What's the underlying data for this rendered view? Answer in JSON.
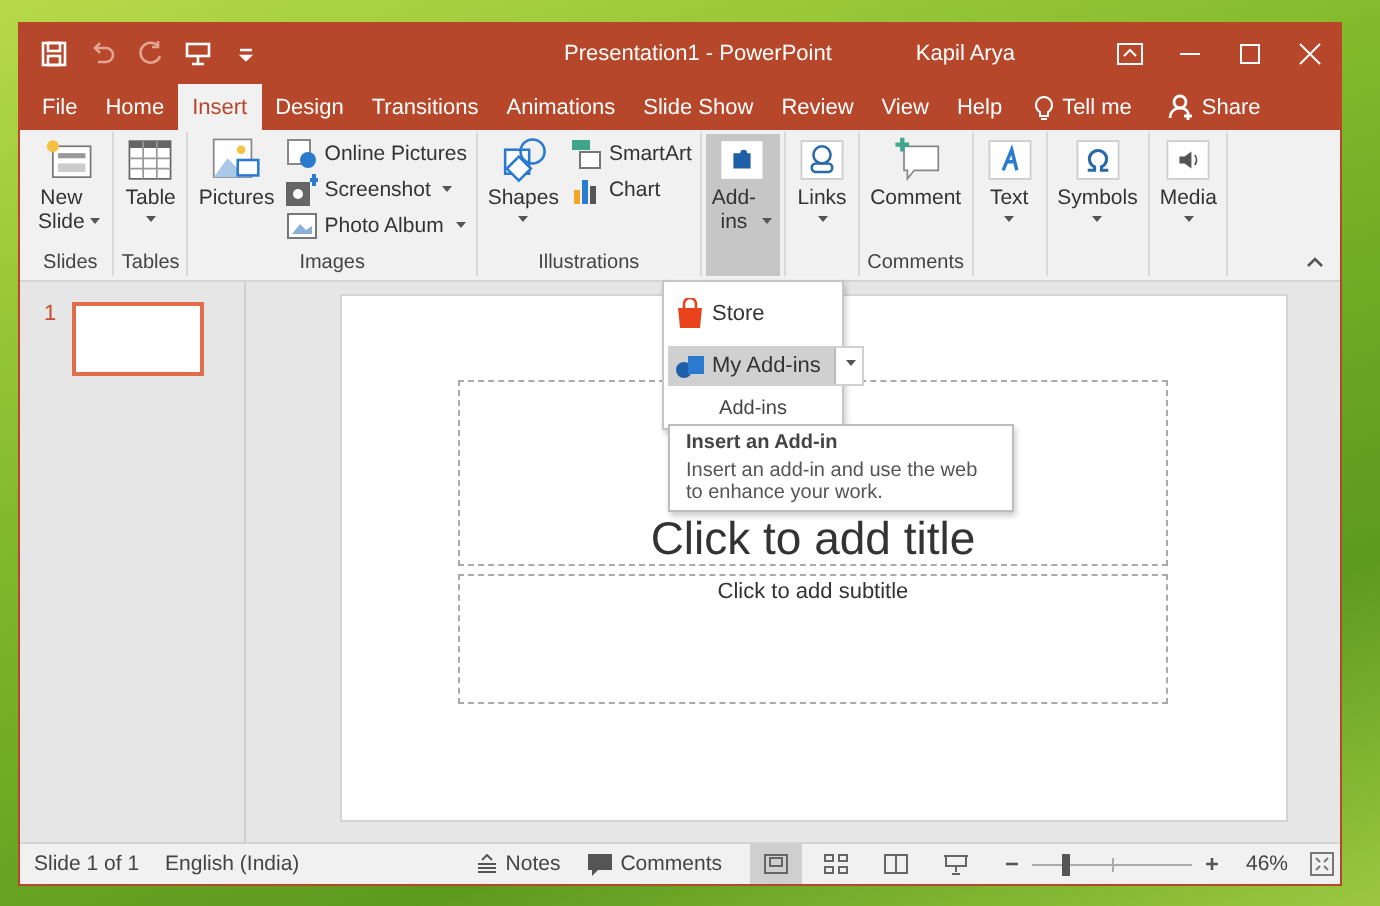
{
  "window": {
    "title": "Presentation1 - PowerPoint",
    "user": "Kapil Arya"
  },
  "quick_access": [
    {
      "kind": "save",
      "disabled": false
    },
    {
      "kind": "undo",
      "disabled": true
    },
    {
      "kind": "redo",
      "disabled": true
    },
    {
      "kind": "present",
      "disabled": false
    },
    {
      "kind": "customize",
      "disabled": false
    }
  ],
  "tabs": [
    {
      "label": "File",
      "selected": false
    },
    {
      "label": "Home",
      "selected": false
    },
    {
      "label": "Insert",
      "selected": true
    },
    {
      "label": "Design",
      "selected": false
    },
    {
      "label": "Transitions",
      "selected": false
    },
    {
      "label": "Animations",
      "selected": false
    },
    {
      "label": "Slide Show",
      "selected": false
    },
    {
      "label": "Review",
      "selected": false
    },
    {
      "label": "View",
      "selected": false
    },
    {
      "label": "Help",
      "selected": false
    }
  ],
  "tell_me": "Tell me",
  "share": "Share",
  "ribbon": {
    "groups": [
      {
        "label": "Slides",
        "controls": [
          {
            "kind": "new-slide",
            "label": "New Slide",
            "dropdown": true,
            "wrapped": true,
            "pressed": false
          }
        ]
      },
      {
        "label": "Tables",
        "controls": [
          {
            "kind": "table",
            "label": "Table",
            "dropdown": true,
            "wrapped": false,
            "pressed": false
          }
        ]
      },
      {
        "label": "Images",
        "controls": [
          {
            "kind": "pictures",
            "label": "Pictures",
            "dropdown": false,
            "pressed": false
          },
          {
            "kind": "column",
            "items": [
              {
                "kind": "online-pictures",
                "label": "Online Pictures",
                "dropdown": false,
                "pressed": false
              },
              {
                "kind": "screenshot",
                "label": "Screenshot",
                "dropdown": true,
                "pressed": false
              },
              {
                "kind": "photo-album",
                "label": "Photo Album",
                "dropdown": true,
                "pressed": false
              }
            ]
          }
        ]
      },
      {
        "label": "Illustrations",
        "controls": [
          {
            "kind": "shapes",
            "label": "Shapes",
            "dropdown": true,
            "wrapped": false,
            "pressed": false
          },
          {
            "kind": "column",
            "items": [
              {
                "kind": "smartart",
                "label": "SmartArt",
                "dropdown": false,
                "pressed": false
              },
              {
                "kind": "chart",
                "label": "Chart",
                "dropdown": false,
                "pressed": false
              }
            ]
          }
        ]
      },
      {
        "controls": [
          {
            "kind": "add-ins",
            "label": "Add-ins",
            "dropdown": true,
            "wrapped": true,
            "pressed": true
          }
        ]
      },
      {
        "controls": [
          {
            "kind": "links",
            "label": "Links",
            "dropdown": true,
            "wrapped": false,
            "pressed": false
          }
        ]
      },
      {
        "label": "Comments",
        "controls": [
          {
            "kind": "comment",
            "label": "Comment",
            "dropdown": false,
            "pressed": false
          }
        ]
      },
      {
        "controls": [
          {
            "kind": "text",
            "label": "Text",
            "dropdown": true,
            "wrapped": false,
            "pressed": false
          }
        ]
      },
      {
        "controls": [
          {
            "kind": "symbols",
            "label": "Symbols",
            "dropdown": true,
            "wrapped": false,
            "pressed": false
          }
        ]
      },
      {
        "controls": [
          {
            "kind": "media",
            "label": "Media",
            "dropdown": true,
            "wrapped": false,
            "pressed": false
          }
        ]
      }
    ]
  },
  "addins_menu": {
    "items": [
      {
        "kind": "store",
        "label": "Store",
        "selected": false
      },
      {
        "kind": "my-addins",
        "label": "My Add-ins",
        "selected": true
      }
    ],
    "label": "Add-ins"
  },
  "tooltip": {
    "title": "Insert an Add-in",
    "text": "Insert an add-in and use the web to enhance your work."
  },
  "slides": [
    {
      "number": "1",
      "selected": true
    }
  ],
  "slide": {
    "title_prompt": "Click to add title",
    "subtitle_prompt": "Click to add subtitle"
  },
  "status_bar": {
    "slide_info": "Slide 1 of 1",
    "language": "English (India)",
    "notes": "Notes",
    "comments": "Comments",
    "views": [
      {
        "kind": "normal",
        "selected": true
      },
      {
        "kind": "sorter",
        "selected": false
      },
      {
        "kind": "reading",
        "selected": false
      },
      {
        "kind": "slideshow",
        "selected": false
      }
    ],
    "zoom": {
      "level": 0.21,
      "reading": "46%"
    }
  }
}
